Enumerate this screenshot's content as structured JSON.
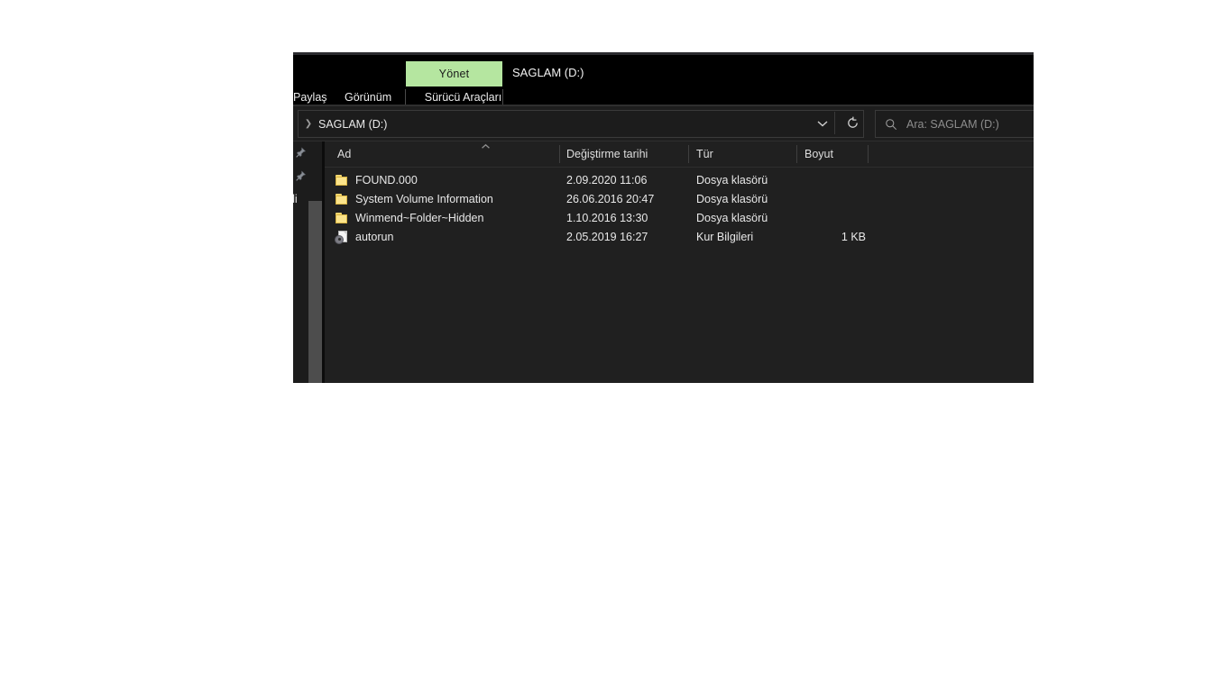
{
  "window": {
    "title": "SAGLAM (D:)"
  },
  "ribbon": {
    "contextual_tab": "Yönet",
    "tabs": [
      {
        "label": "Paylaş"
      },
      {
        "label": "Görünüm"
      },
      {
        "label": "Sürücü Araçları"
      }
    ],
    "accent_color": "#b5e6a0"
  },
  "addressbar": {
    "path": "SAGLAM (D:)",
    "path_separator_icon": "chevron-right-icon",
    "dropdown_icon": "chevron-down-icon",
    "refresh_icon": "refresh-icon"
  },
  "search": {
    "icon": "search-icon",
    "placeholder": "Ara: SAGLAM (D:)"
  },
  "navigation_pane": {
    "collapse_icon": "chevron-up-icon",
    "items": [
      {
        "icon": "pin-icon",
        "label": ""
      },
      {
        "icon": "pin-icon",
        "label": ""
      },
      {
        "icon": "",
        "label": "ndi"
      }
    ]
  },
  "file_list": {
    "columns": [
      {
        "key": "name",
        "label": "Ad",
        "sorted": true,
        "sort_icon": "chevron-up-icon"
      },
      {
        "key": "date",
        "label": "Değiştirme tarihi"
      },
      {
        "key": "type",
        "label": "Tür"
      },
      {
        "key": "size",
        "label": "Boyut"
      }
    ],
    "rows": [
      {
        "icon": "folder-icon",
        "name": "FOUND.000",
        "date": "2.09.2020 11:06",
        "type": "Dosya klasörü",
        "size": ""
      },
      {
        "icon": "folder-icon",
        "name": "System Volume Information",
        "date": "26.06.2016 20:47",
        "type": "Dosya klasörü",
        "size": ""
      },
      {
        "icon": "folder-icon",
        "name": "Winmend~Folder~Hidden",
        "date": "1.10.2016 13:30",
        "type": "Dosya klasörü",
        "size": ""
      },
      {
        "icon": "setup-information-icon",
        "name": "autorun",
        "date": "2.05.2019 16:27",
        "type": "Kur Bilgileri",
        "size": "1 KB"
      }
    ]
  },
  "colors": {
    "window_background": "#1e1e1e",
    "ribbon_background": "#000000",
    "list_background": "#202020",
    "folder_icon": "#fbe38a",
    "text": "#e8e8e8"
  }
}
